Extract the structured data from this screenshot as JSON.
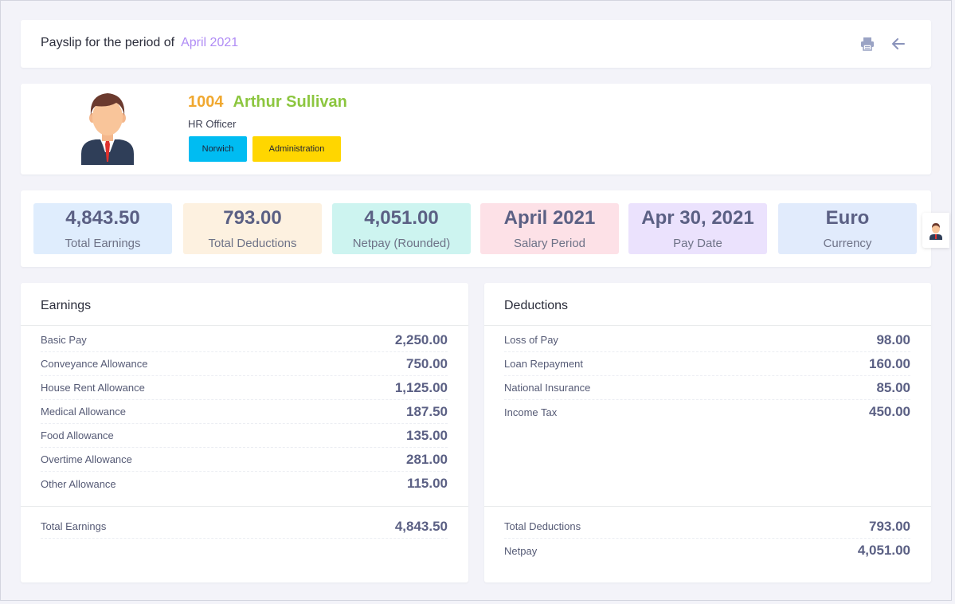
{
  "header": {
    "title_prefix": "Payslip for the period of",
    "period": "April 2021",
    "print_icon": "printer-icon",
    "back_icon": "arrow-left-icon"
  },
  "employee": {
    "id": "1004",
    "name": "Arthur Sullivan",
    "role": "HR Officer",
    "location": "Norwich",
    "department": "Administration",
    "avatar_icon": "avatar-businessman-icon"
  },
  "stats": [
    {
      "value": "4,843.50",
      "label": "Total Earnings"
    },
    {
      "value": "793.00",
      "label": "Total Deductions"
    },
    {
      "value": "4,051.00",
      "label": "Netpay (Rounded)"
    },
    {
      "value": "April 2021",
      "label": "Salary Period"
    },
    {
      "value": "Apr 30, 2021",
      "label": "Pay Date"
    },
    {
      "value": "Euro",
      "label": "Currency"
    }
  ],
  "earnings": {
    "title": "Earnings",
    "items": [
      {
        "label": "Basic Pay",
        "value": "2,250.00"
      },
      {
        "label": "Conveyance Allowance",
        "value": "750.00"
      },
      {
        "label": "House Rent Allowance",
        "value": "1,125.00"
      },
      {
        "label": "Medical Allowance",
        "value": "187.50"
      },
      {
        "label": "Food Allowance",
        "value": "135.00"
      },
      {
        "label": "Overtime Allowance",
        "value": "281.00"
      },
      {
        "label": "Other Allowance",
        "value": "115.00"
      }
    ],
    "totals": [
      {
        "label": "Total Earnings",
        "value": "4,843.50"
      }
    ]
  },
  "deductions": {
    "title": "Deductions",
    "items": [
      {
        "label": "Loss of Pay",
        "value": "98.00"
      },
      {
        "label": "Loan Repayment",
        "value": "160.00"
      },
      {
        "label": "National Insurance",
        "value": "85.00"
      },
      {
        "label": "Income Tax",
        "value": "450.00"
      }
    ],
    "totals": [
      {
        "label": "Total Deductions",
        "value": "793.00"
      },
      {
        "label": "Netpay",
        "value": "4,051.00"
      }
    ]
  },
  "colors": {
    "period": "#b08cf5",
    "employee_id": "#f0a830",
    "employee_name": "#8cc63f",
    "tag_location": "#00bcf2",
    "tag_department": "#ffd600"
  }
}
